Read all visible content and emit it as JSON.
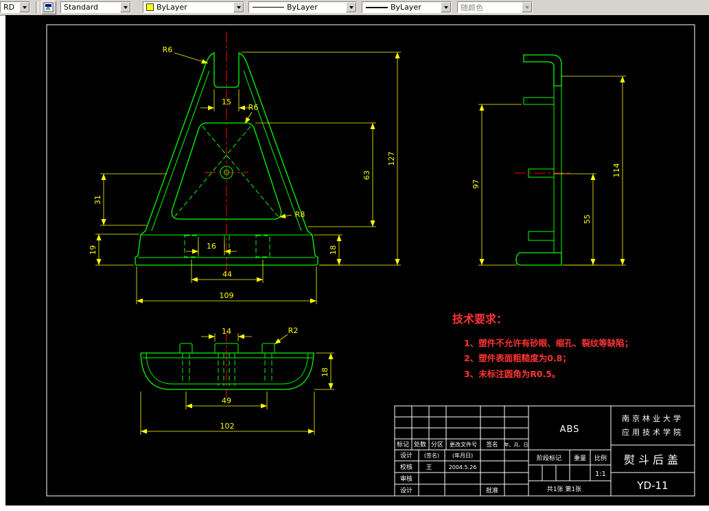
{
  "toolbar": {
    "layer_combo": {
      "value": "RD"
    },
    "style_combo": {
      "value": "Standard"
    },
    "color_combo": {
      "value": "ByLayer"
    },
    "linetype_combo": {
      "value": "ByLayer"
    },
    "lineweight_combo": {
      "value": "ByLayer"
    },
    "plotstyle_combo": {
      "value": "随颜色"
    }
  },
  "colors": {
    "current_color": "#ffff00",
    "geometry": "#00ff00",
    "dimension": "#ffff00",
    "centerline": "#ff0000",
    "tech_text": "#ff3333",
    "border": "#ffffff",
    "canvas_background": "#000000"
  },
  "views": {
    "front": {
      "dims": {
        "slot_width": "15",
        "fillet_top": "R6",
        "fillet_pocket": "R6",
        "overall_height": "127",
        "pocket_height": "63",
        "wall_height": "31",
        "base_height": "19",
        "boss_gap": "16",
        "rim_height": "18",
        "boss_spacing": "44",
        "overall_width": "109",
        "corner_fillet": "R8"
      }
    },
    "side": {
      "dims": {
        "inner_height": "97",
        "overall_height": "114",
        "boss_height": "55"
      }
    },
    "bottom": {
      "dims": {
        "slot_width": "14",
        "fillet": "R2",
        "rib_spacing": "49",
        "rim_depth": "18",
        "overall_width": "102"
      }
    }
  },
  "tech_requirements": {
    "title": "技术要求：",
    "items": [
      "1、塑件不允许有砂眼、缩孔、裂纹等缺陷；",
      "2、塑件表面粗糙度为0.8；",
      "3、未标注圆角为R0.5。"
    ]
  },
  "title_block": {
    "material": "ABS",
    "org_line1": "南京林业大学",
    "org_line2": "应用技术学院",
    "part_name": "熨斗后盖",
    "drawing_number": "YD-11",
    "header_row": {
      "mark": "标记",
      "count": "处数",
      "zone": "分区",
      "change_doc": "更改文件号",
      "sign": "签名",
      "date": "年、月、日"
    },
    "design_row": {
      "label": "设计",
      "sign": "(签名)",
      "date": "(年月日)"
    },
    "check_row": {
      "label": "校核",
      "sign": "王",
      "date": "2004.5.26"
    },
    "audit_row": {
      "label": "审核"
    },
    "bottom_row": {
      "label": "设计",
      "approve": "批准"
    },
    "stage_mark": "阶段标记",
    "weight_label": "重量",
    "scale_label": "比例",
    "scale_value": "1:1",
    "sheet_info": "共1张  第1张"
  }
}
